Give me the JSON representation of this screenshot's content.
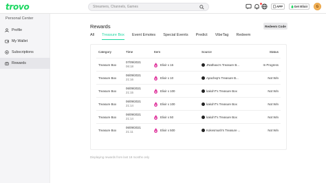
{
  "header": {
    "logo": "trovo",
    "search_placeholder": "Streamers, Channels, Games",
    "app_label": "APP",
    "elixir_label": "Get Elixir",
    "avatar_letter": "G"
  },
  "sidebar": {
    "title": "Personal Center",
    "items": [
      {
        "label": "Profile",
        "icon": "user-icon"
      },
      {
        "label": "My Wallet",
        "icon": "wallet-icon"
      },
      {
        "label": "Subscriptions",
        "icon": "subscriptions-icon"
      },
      {
        "label": "Rewards",
        "icon": "rewards-icon",
        "active": true
      }
    ]
  },
  "main": {
    "title": "Rewards",
    "redeem_button": "Redeem Code",
    "tabs": [
      "All",
      "Treasure Box",
      "Event Emotes",
      "Special Events",
      "Predict",
      "VibeTag",
      "Redeem"
    ],
    "active_tab": "Treasure Box",
    "columns": [
      "Category",
      "Time",
      "Item",
      "Source",
      "Status"
    ],
    "rows": [
      {
        "category": "Treasure Box",
        "date": "07/09/2021",
        "time": "06:18",
        "item": "Elixir x 16",
        "source": "JNathaxo's Treasure B...",
        "status": "In Progress"
      },
      {
        "category": "Treasure Box",
        "date": "06/09/2021",
        "time": "21:16",
        "item": "Elixir x 10",
        "source": "Apachep's Treasure B...",
        "status": "Not Win"
      },
      {
        "category": "Treasure Box",
        "date": "06/09/2021",
        "time": "21:15",
        "item": "Elixir x 100",
        "source": "kakohT's Treasure Box",
        "status": "Not Win"
      },
      {
        "category": "Treasure Box",
        "date": "06/09/2021",
        "time": "21:14",
        "item": "Elixir x 100",
        "source": "kakohT's Treasure Box",
        "status": "Not Win"
      },
      {
        "category": "Treasure Box",
        "date": "06/09/2021",
        "time": "21:14",
        "item": "Elixir x 50",
        "source": "kakohT's Treasure Box",
        "status": "Not Win"
      },
      {
        "category": "Treasure Box",
        "date": "06/09/2021",
        "time": "21:11",
        "item": "Elixir x 500",
        "source": "Kokesmush's Treasure ...",
        "status": "Not Win"
      }
    ],
    "footnote": "Displaying rewards from last 18 months only"
  },
  "colors": {
    "brand": "#1bd760",
    "tab_active": "#1bd7a0",
    "flame": "#e0389e"
  }
}
